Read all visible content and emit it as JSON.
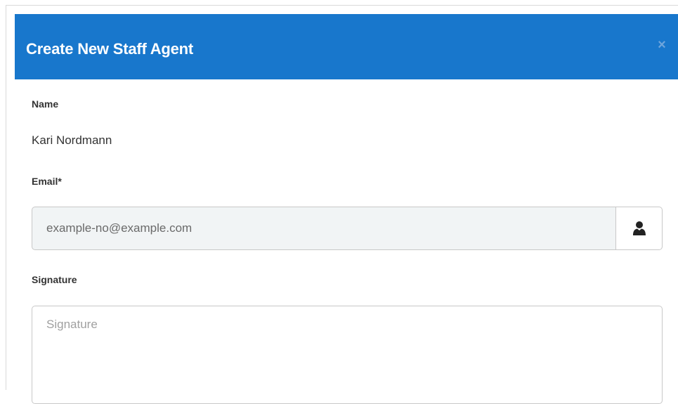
{
  "modal": {
    "title": "Create New Staff Agent",
    "close_label": "×"
  },
  "form": {
    "name_label": "Name",
    "name_value": "Kari Nordmann",
    "email_label": "Email*",
    "email_value": "example-no@example.com",
    "email_addon_icon": "user-icon",
    "signature_label": "Signature",
    "signature_placeholder": "Signature"
  },
  "colors": {
    "header_bg": "#1877cc",
    "header_text": "#ffffff",
    "input_bg": "#f1f4f5"
  }
}
